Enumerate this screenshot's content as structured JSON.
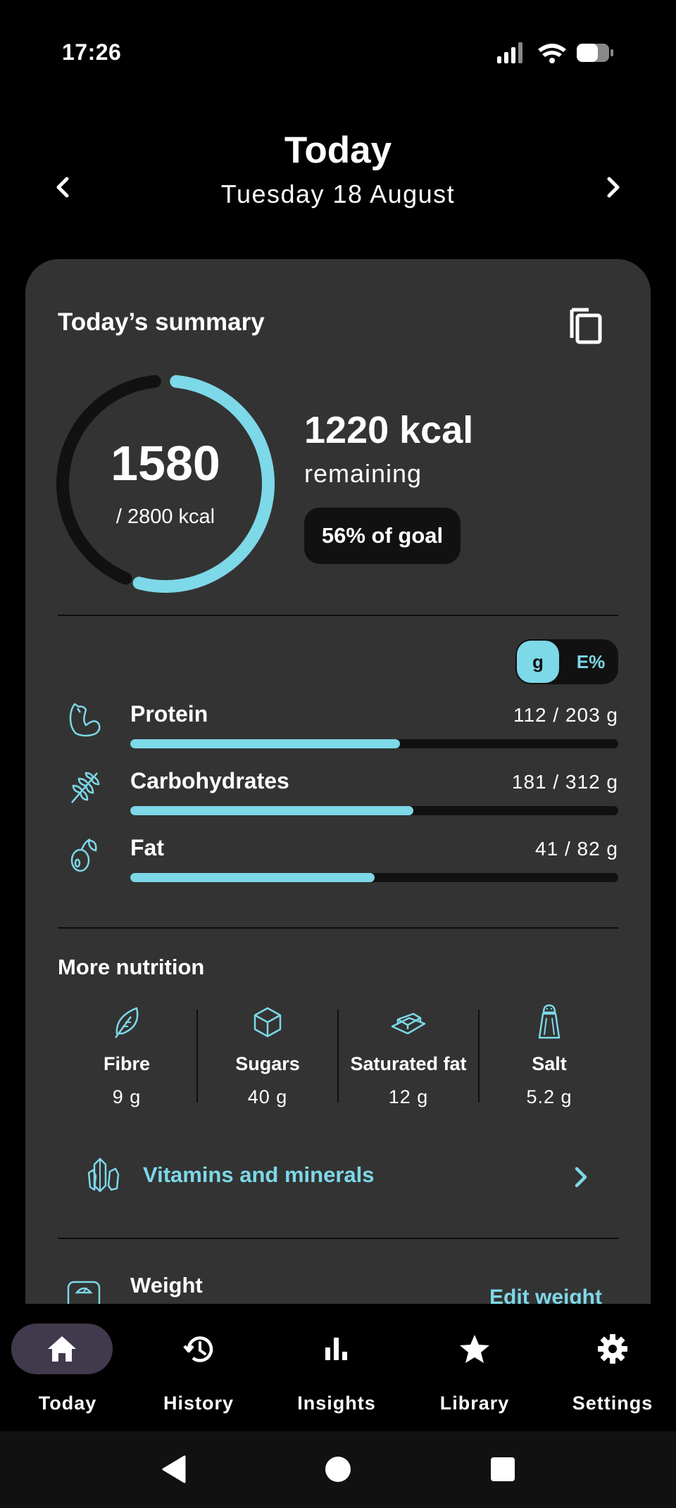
{
  "status_bar": {
    "time": "17:26"
  },
  "header": {
    "title": "Today",
    "date": "Tuesday 18 August"
  },
  "summary": {
    "title": "Today’s summary",
    "consumed": "1580",
    "goal_text": "/ 2800 kcal",
    "remaining_value": "1220 kcal",
    "remaining_label": "remaining",
    "goal_pill": "56% of goal",
    "progress_fraction": 0.564,
    "accent_color": "#7dd8e8"
  },
  "unit_toggle": {
    "grams_label": "g",
    "energy_label": "E%",
    "selected": "g"
  },
  "macros": [
    {
      "name": "Protein",
      "value": "112 / 203 g",
      "fraction": 0.552,
      "icon": "muscle-icon"
    },
    {
      "name": "Carbohydrates",
      "value": "181 / 312 g",
      "fraction": 0.58,
      "icon": "wheat-icon"
    },
    {
      "name": "Fat",
      "value": "41 / 82 g",
      "fraction": 0.5,
      "icon": "olive-icon"
    }
  ],
  "more_nutrition": {
    "title": "More nutrition",
    "items": [
      {
        "name": "Fibre",
        "value": "9 g",
        "icon": "leaf-icon"
      },
      {
        "name": "Sugars",
        "value": "40 g",
        "icon": "sugar-cube-icon"
      },
      {
        "name": "Saturated fat",
        "value": "12 g",
        "icon": "butter-icon"
      },
      {
        "name": "Salt",
        "value": "5.2 g",
        "icon": "salt-shaker-icon"
      }
    ],
    "vitamins_label": "Vitamins and minerals"
  },
  "weight": {
    "label": "Weight",
    "edit_label": "Edit weight"
  },
  "bottom_nav": [
    {
      "label": "Today",
      "icon": "home-icon",
      "active": true
    },
    {
      "label": "History",
      "icon": "history-icon",
      "active": false
    },
    {
      "label": "Insights",
      "icon": "bar-chart-icon",
      "active": false
    },
    {
      "label": "Library",
      "icon": "star-icon",
      "active": false
    },
    {
      "label": "Settings",
      "icon": "gear-icon",
      "active": false
    }
  ]
}
